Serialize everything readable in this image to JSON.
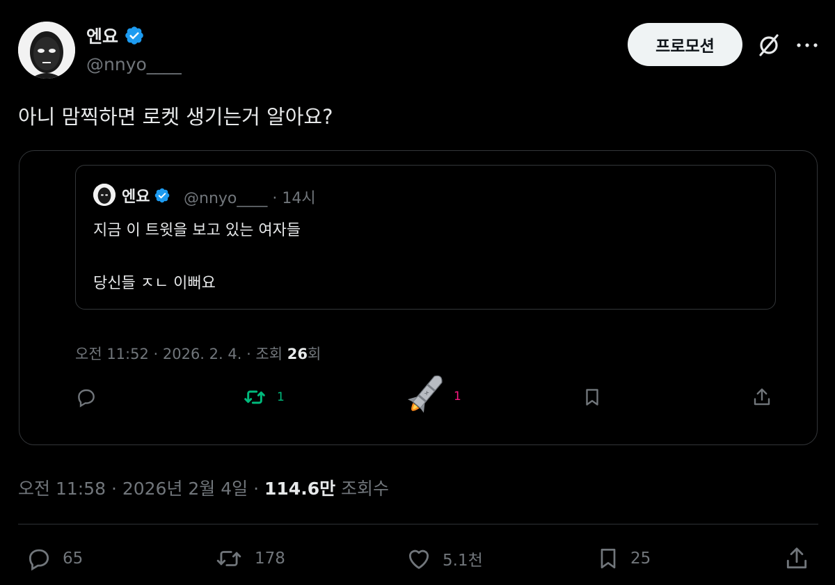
{
  "author": {
    "display_name": "엔요",
    "handle": "@nnyo____",
    "verified_color": "#1d9bf0"
  },
  "header": {
    "promo_label": "프로모션",
    "grok_icon": "slashed-circle-icon",
    "more_icon": "more-icon"
  },
  "tweet": {
    "text": "아니 맘찍하면 로켓 생기는거 알아요?"
  },
  "quoted": {
    "display_name": "엔요",
    "handle_time": "@nnyo____ · 14시",
    "line1": "지금 이 트윗을 보고 있는 여자들",
    "line2": "당신들 ㅈㄴ 이뻐요",
    "meta_prefix": "오전 11:52 · 2026. 2. 4. · 조회 ",
    "meta_views": "26",
    "meta_suffix": "회",
    "actions": {
      "reply_count": "",
      "retweet_count": "1",
      "like_count": "1",
      "retweet_color": "#00ba7c",
      "like_color": "#f91880"
    }
  },
  "meta": {
    "time_date": "오전 11:58 · 2026년 2월 4일 · ",
    "views": "114.6만",
    "views_label": " 조회수"
  },
  "actions": {
    "replies": "65",
    "retweets": "178",
    "likes": "5.1천",
    "bookmarks": "25"
  }
}
